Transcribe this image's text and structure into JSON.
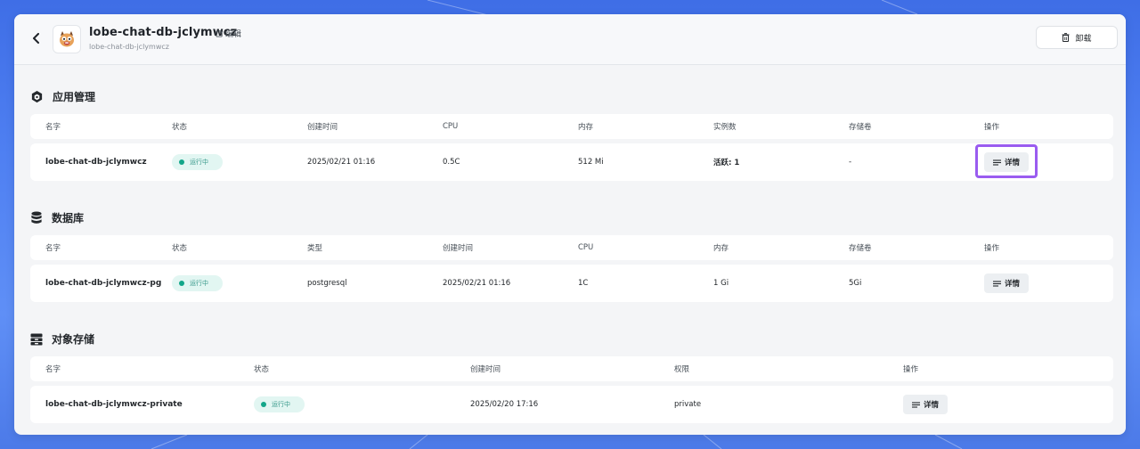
{
  "header": {
    "back_icon": "chevron-left-icon",
    "app_icon": "monster-avatar-icon",
    "title": "lobe-chat-db-jclymwcz",
    "subtitle": "lobe-chat-db-jclymwcz",
    "edit_label": "编辑",
    "uninstall_label": "卸载"
  },
  "apps": {
    "title": "应用管理",
    "icon": "hexagon-icon",
    "columns": [
      "名字",
      "状态",
      "创建时间",
      "CPU",
      "内存",
      "实例数",
      "存储卷",
      "操作"
    ],
    "rows": [
      {
        "name": "lobe-chat-db-jclymwcz",
        "status": "运行中",
        "created": "2025/02/21 01:16",
        "cpu": "0.5C",
        "memory": "512 Mi",
        "instances": "活跃: 1",
        "volume": "-",
        "action": "详情"
      }
    ]
  },
  "databases": {
    "title": "数据库",
    "icon": "database-icon",
    "columns": [
      "名字",
      "状态",
      "类型",
      "创建时间",
      "CPU",
      "内存",
      "存储卷",
      "操作"
    ],
    "rows": [
      {
        "name": "lobe-chat-db-jclymwcz-pg",
        "status": "运行中",
        "type": "postgresql",
        "created": "2025/02/21 01:16",
        "cpu": "1C",
        "memory": "1 Gi",
        "volume": "5Gi",
        "action": "详情"
      }
    ]
  },
  "storage": {
    "title": "对象存储",
    "icon": "archive-icon",
    "columns": [
      "名字",
      "状态",
      "创建时间",
      "权限",
      "操作"
    ],
    "rows": [
      {
        "name": "lobe-chat-db-jclymwcz-private",
        "status": "运行中",
        "created": "2025/02/20 17:16",
        "permission": "private",
        "action": "详情"
      }
    ]
  },
  "colors": {
    "status_bg": "#e2f6f2",
    "status_dot": "#12a689",
    "highlight": "#9a5cf0"
  }
}
